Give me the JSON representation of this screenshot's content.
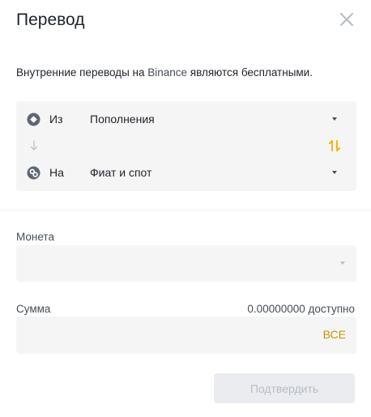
{
  "dialog": {
    "title": "Перевод"
  },
  "notice": {
    "prefix": "Внутренние переводы на ",
    "brand": "Binance",
    "suffix": " являются бесплатными."
  },
  "transfer": {
    "from_label": "Из",
    "from_value": "Пополнения",
    "to_label": "На",
    "to_value": "Фиат и спот"
  },
  "coin": {
    "label": "Монета",
    "value": ""
  },
  "amount": {
    "label": "Сумма",
    "available": "0.00000000 доступно",
    "value": "",
    "max_label": "ВСЕ"
  },
  "actions": {
    "confirm_label": "Подтвердить"
  },
  "colors": {
    "accent": "#c99400",
    "field_bg": "#f5f5f5",
    "disabled_bg": "#eaecef",
    "disabled_text": "#b7bdc6"
  },
  "icons": {
    "close": "close-icon",
    "from_wallet": "funding-wallet-icon",
    "to_wallet": "spot-wallet-icon",
    "down_arrow": "arrow-down-icon",
    "swap": "swap-icon",
    "dropdown": "chevron-down-icon"
  }
}
